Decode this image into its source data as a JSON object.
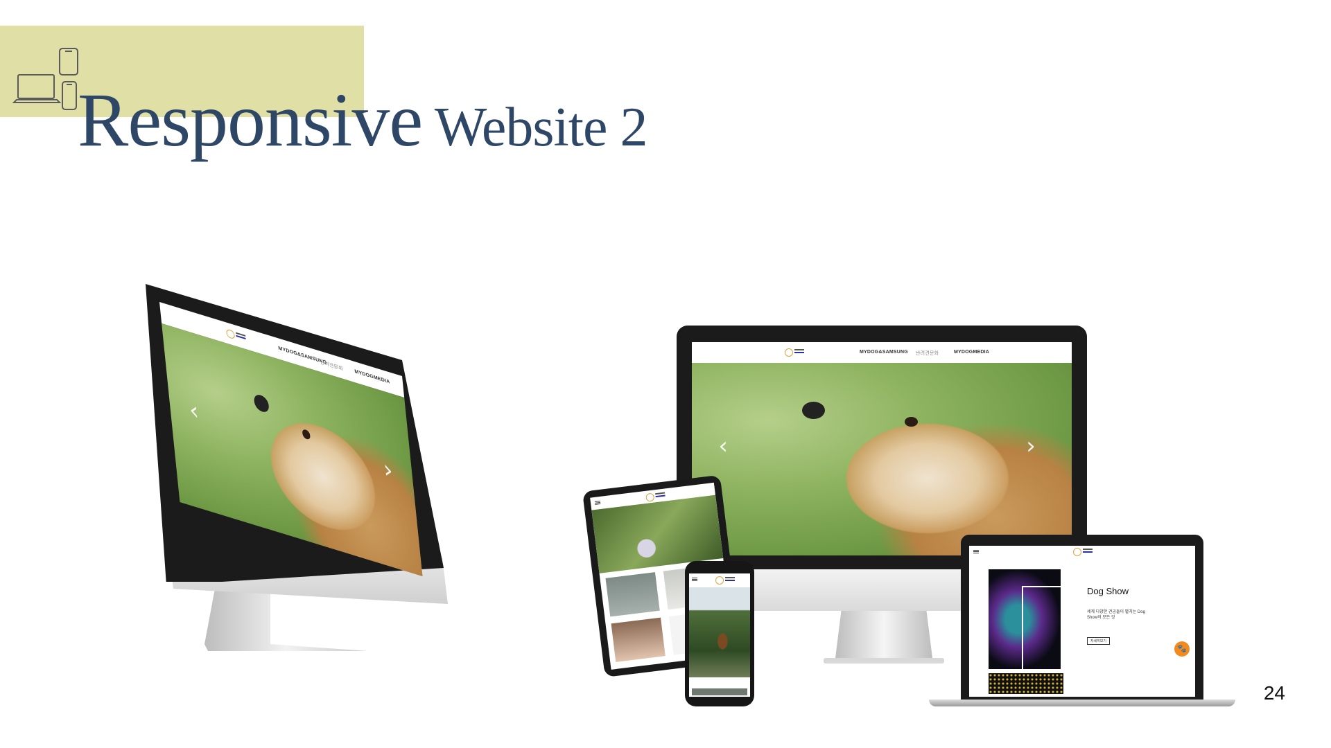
{
  "slide": {
    "title_big": "Responsive",
    "title_small": " Website 2",
    "page_number": "24"
  },
  "site": {
    "nav": [
      "MYDOG&SAMSUNG",
      "반려견문화",
      "MYDOGMEDIA"
    ],
    "prev_arrow": "‹",
    "next_arrow": "›"
  },
  "laptop_screen": {
    "heading": "Dog Show",
    "description": "세계 다양한 견공들이 펼치는 Dog Show의 모든 것",
    "button_label": "자세히보기"
  },
  "colors": {
    "title_bar": "#e0dfa6",
    "title_text": "#2e4766",
    "accent_orange": "#f28a1c"
  },
  "icons": [
    "devices-icon",
    "hamburger-icon",
    "paw-icon",
    "chevron-left-icon",
    "chevron-right-icon"
  ]
}
